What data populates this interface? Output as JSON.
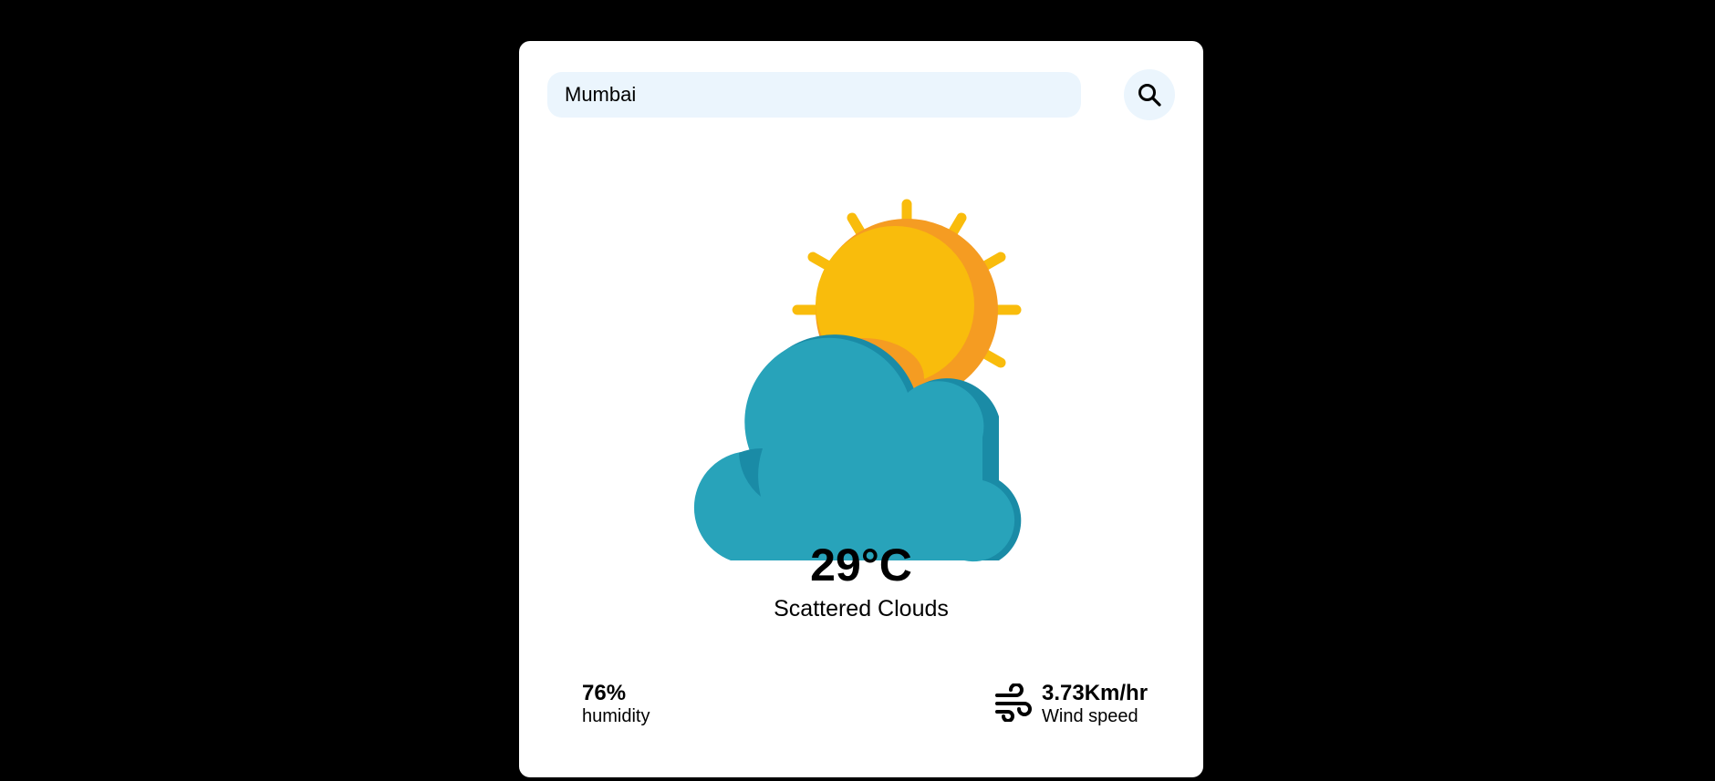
{
  "search": {
    "value": "Mumbai",
    "icon": "search-icon"
  },
  "weather": {
    "icon": "partly-cloudy-icon",
    "temperature": "29°C",
    "condition": "Scattered Clouds"
  },
  "humidity": {
    "value": "76%",
    "label": "humidity"
  },
  "wind": {
    "icon": "wind-icon",
    "value": "3.73Km/hr",
    "label": "Wind speed"
  },
  "colors": {
    "background": "#000000",
    "card": "#ffffff",
    "search_fill": "#ebf5fd",
    "sun": "#f9bc0c",
    "sun_shade": "#f59c22",
    "cloud": "#28a3ba",
    "cloud_shade": "#1a8ba6"
  }
}
